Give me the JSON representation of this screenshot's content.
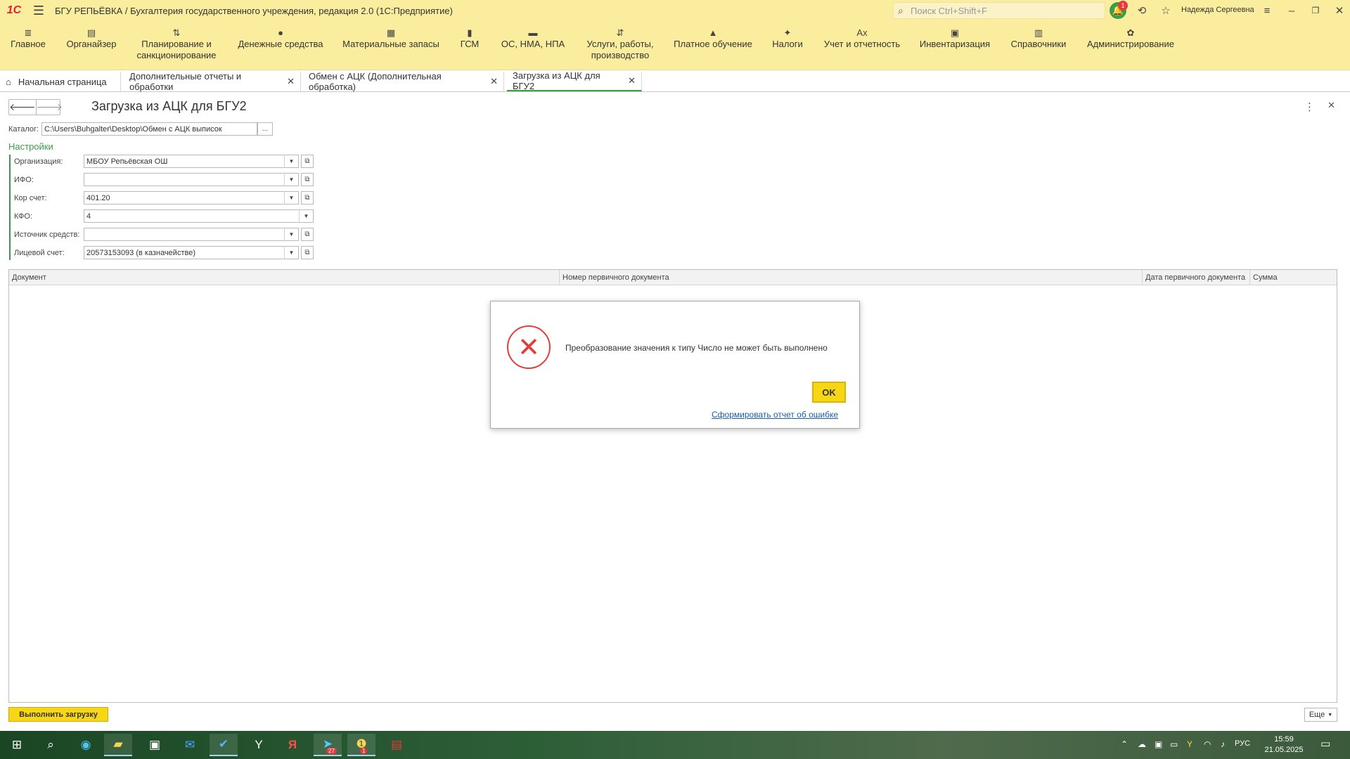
{
  "titlebar": {
    "logo": "1С",
    "title": "БГУ РЕПЬЁВКА / Бухгалтерия государственного учреждения, редакция 2.0  (1С:Предприятие)",
    "search_placeholder": "Поиск Ctrl+Shift+F",
    "notification_count": "1",
    "user_name": "Надежда Сергеевна"
  },
  "sections": [
    {
      "label": "Главное",
      "icon": "menu-icon"
    },
    {
      "label": "Органайзер",
      "icon": "clipboard-icon"
    },
    {
      "label": "Планирование и\nсанкционирование",
      "icon": "planning-icon"
    },
    {
      "label": "Денежные средства",
      "icon": "ruble-icon"
    },
    {
      "label": "Материальные запасы",
      "icon": "grid-icon"
    },
    {
      "label": "ГСМ",
      "icon": "fuel-icon"
    },
    {
      "label": "ОС, НМА, НПА",
      "icon": "truck-icon"
    },
    {
      "label": "Услуги, работы,\nпроизводство",
      "icon": "tools-icon"
    },
    {
      "label": "Платное обучение",
      "icon": "graduation-icon"
    },
    {
      "label": "Налоги",
      "icon": "emblem-icon"
    },
    {
      "label": "Учет и отчетность",
      "icon": "accounting-icon"
    },
    {
      "label": "Инвентаризация",
      "icon": "inventory-icon"
    },
    {
      "label": "Справочники",
      "icon": "books-icon"
    },
    {
      "label": "Администрирование",
      "icon": "gear-icon"
    }
  ],
  "tabs": [
    {
      "label": "Начальная страница"
    },
    {
      "label": "Дополнительные отчеты и обработки"
    },
    {
      "label": "Обмен с АЦК (Дополнительная обработка)"
    },
    {
      "label": "Загрузка из АЦК для БГУ2"
    }
  ],
  "form": {
    "title": "Загрузка из АЦК для БГУ2",
    "catalog_label": "Каталог:",
    "catalog_value": "C:\\Users\\Buhgalter\\Desktop\\Обмен с АЦК выписок",
    "catalog_button": "...",
    "settings_title": "Настройки",
    "fields": {
      "org": {
        "label": "Организация:",
        "value": "МБОУ Репьёвская ОШ"
      },
      "ifo": {
        "label": "ИФО:",
        "value": ""
      },
      "kor": {
        "label": "Кор счет:",
        "value": "401.20"
      },
      "kfo": {
        "label": "КФО:",
        "value": "4"
      },
      "src": {
        "label": "Источник средств:",
        "value": ""
      },
      "acc": {
        "label": "Лицевой счет:",
        "value": "20573153093 (в казначействе)"
      }
    }
  },
  "table": {
    "columns": [
      "Документ",
      "Номер первичного документа",
      "Дата первичного документа",
      "Сумма"
    ]
  },
  "dialog": {
    "message": "Преобразование значения к типу Число не может быть выполнено",
    "ok_label": "OK",
    "report_link": "Сформировать отчет об ошибке"
  },
  "footer": {
    "run_label": "Выполнить загрузку",
    "more_label": "Еще"
  },
  "taskbar": {
    "telegram_badge": "27",
    "onec_badge": "1",
    "lang": "РУС",
    "time": "15:59",
    "date": "21.05.2025"
  },
  "colors": {
    "panel": "#fbed9e",
    "accent_green": "#3c9b4b",
    "button_yellow": "#f7d616",
    "error_red": "#e53b3b",
    "link_blue": "#1d5aa9"
  }
}
